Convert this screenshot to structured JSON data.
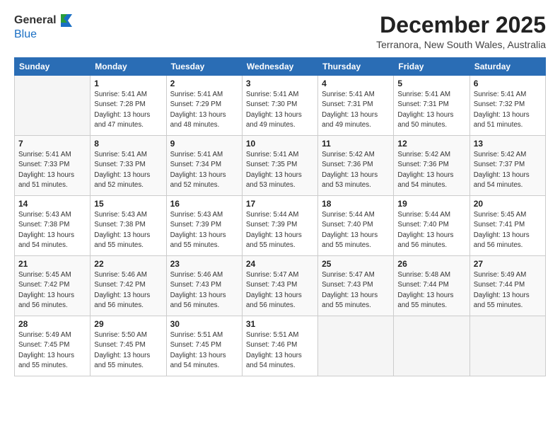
{
  "header": {
    "logo_general": "General",
    "logo_blue": "Blue",
    "month_title": "December 2025",
    "location": "Terranora, New South Wales, Australia"
  },
  "days_of_week": [
    "Sunday",
    "Monday",
    "Tuesday",
    "Wednesday",
    "Thursday",
    "Friday",
    "Saturday"
  ],
  "weeks": [
    [
      {
        "day": "",
        "sunrise": "",
        "sunset": "",
        "daylight": ""
      },
      {
        "day": "1",
        "sunrise": "Sunrise: 5:41 AM",
        "sunset": "Sunset: 7:28 PM",
        "daylight": "Daylight: 13 hours and 47 minutes."
      },
      {
        "day": "2",
        "sunrise": "Sunrise: 5:41 AM",
        "sunset": "Sunset: 7:29 PM",
        "daylight": "Daylight: 13 hours and 48 minutes."
      },
      {
        "day": "3",
        "sunrise": "Sunrise: 5:41 AM",
        "sunset": "Sunset: 7:30 PM",
        "daylight": "Daylight: 13 hours and 49 minutes."
      },
      {
        "day": "4",
        "sunrise": "Sunrise: 5:41 AM",
        "sunset": "Sunset: 7:31 PM",
        "daylight": "Daylight: 13 hours and 49 minutes."
      },
      {
        "day": "5",
        "sunrise": "Sunrise: 5:41 AM",
        "sunset": "Sunset: 7:31 PM",
        "daylight": "Daylight: 13 hours and 50 minutes."
      },
      {
        "day": "6",
        "sunrise": "Sunrise: 5:41 AM",
        "sunset": "Sunset: 7:32 PM",
        "daylight": "Daylight: 13 hours and 51 minutes."
      }
    ],
    [
      {
        "day": "7",
        "sunrise": "Sunrise: 5:41 AM",
        "sunset": "Sunset: 7:33 PM",
        "daylight": "Daylight: 13 hours and 51 minutes."
      },
      {
        "day": "8",
        "sunrise": "Sunrise: 5:41 AM",
        "sunset": "Sunset: 7:33 PM",
        "daylight": "Daylight: 13 hours and 52 minutes."
      },
      {
        "day": "9",
        "sunrise": "Sunrise: 5:41 AM",
        "sunset": "Sunset: 7:34 PM",
        "daylight": "Daylight: 13 hours and 52 minutes."
      },
      {
        "day": "10",
        "sunrise": "Sunrise: 5:41 AM",
        "sunset": "Sunset: 7:35 PM",
        "daylight": "Daylight: 13 hours and 53 minutes."
      },
      {
        "day": "11",
        "sunrise": "Sunrise: 5:42 AM",
        "sunset": "Sunset: 7:36 PM",
        "daylight": "Daylight: 13 hours and 53 minutes."
      },
      {
        "day": "12",
        "sunrise": "Sunrise: 5:42 AM",
        "sunset": "Sunset: 7:36 PM",
        "daylight": "Daylight: 13 hours and 54 minutes."
      },
      {
        "day": "13",
        "sunrise": "Sunrise: 5:42 AM",
        "sunset": "Sunset: 7:37 PM",
        "daylight": "Daylight: 13 hours and 54 minutes."
      }
    ],
    [
      {
        "day": "14",
        "sunrise": "Sunrise: 5:43 AM",
        "sunset": "Sunset: 7:38 PM",
        "daylight": "Daylight: 13 hours and 54 minutes."
      },
      {
        "day": "15",
        "sunrise": "Sunrise: 5:43 AM",
        "sunset": "Sunset: 7:38 PM",
        "daylight": "Daylight: 13 hours and 55 minutes."
      },
      {
        "day": "16",
        "sunrise": "Sunrise: 5:43 AM",
        "sunset": "Sunset: 7:39 PM",
        "daylight": "Daylight: 13 hours and 55 minutes."
      },
      {
        "day": "17",
        "sunrise": "Sunrise: 5:44 AM",
        "sunset": "Sunset: 7:39 PM",
        "daylight": "Daylight: 13 hours and 55 minutes."
      },
      {
        "day": "18",
        "sunrise": "Sunrise: 5:44 AM",
        "sunset": "Sunset: 7:40 PM",
        "daylight": "Daylight: 13 hours and 55 minutes."
      },
      {
        "day": "19",
        "sunrise": "Sunrise: 5:44 AM",
        "sunset": "Sunset: 7:40 PM",
        "daylight": "Daylight: 13 hours and 56 minutes."
      },
      {
        "day": "20",
        "sunrise": "Sunrise: 5:45 AM",
        "sunset": "Sunset: 7:41 PM",
        "daylight": "Daylight: 13 hours and 56 minutes."
      }
    ],
    [
      {
        "day": "21",
        "sunrise": "Sunrise: 5:45 AM",
        "sunset": "Sunset: 7:42 PM",
        "daylight": "Daylight: 13 hours and 56 minutes."
      },
      {
        "day": "22",
        "sunrise": "Sunrise: 5:46 AM",
        "sunset": "Sunset: 7:42 PM",
        "daylight": "Daylight: 13 hours and 56 minutes."
      },
      {
        "day": "23",
        "sunrise": "Sunrise: 5:46 AM",
        "sunset": "Sunset: 7:43 PM",
        "daylight": "Daylight: 13 hours and 56 minutes."
      },
      {
        "day": "24",
        "sunrise": "Sunrise: 5:47 AM",
        "sunset": "Sunset: 7:43 PM",
        "daylight": "Daylight: 13 hours and 56 minutes."
      },
      {
        "day": "25",
        "sunrise": "Sunrise: 5:47 AM",
        "sunset": "Sunset: 7:43 PM",
        "daylight": "Daylight: 13 hours and 55 minutes."
      },
      {
        "day": "26",
        "sunrise": "Sunrise: 5:48 AM",
        "sunset": "Sunset: 7:44 PM",
        "daylight": "Daylight: 13 hours and 55 minutes."
      },
      {
        "day": "27",
        "sunrise": "Sunrise: 5:49 AM",
        "sunset": "Sunset: 7:44 PM",
        "daylight": "Daylight: 13 hours and 55 minutes."
      }
    ],
    [
      {
        "day": "28",
        "sunrise": "Sunrise: 5:49 AM",
        "sunset": "Sunset: 7:45 PM",
        "daylight": "Daylight: 13 hours and 55 minutes."
      },
      {
        "day": "29",
        "sunrise": "Sunrise: 5:50 AM",
        "sunset": "Sunset: 7:45 PM",
        "daylight": "Daylight: 13 hours and 55 minutes."
      },
      {
        "day": "30",
        "sunrise": "Sunrise: 5:51 AM",
        "sunset": "Sunset: 7:45 PM",
        "daylight": "Daylight: 13 hours and 54 minutes."
      },
      {
        "day": "31",
        "sunrise": "Sunrise: 5:51 AM",
        "sunset": "Sunset: 7:46 PM",
        "daylight": "Daylight: 13 hours and 54 minutes."
      },
      {
        "day": "",
        "sunrise": "",
        "sunset": "",
        "daylight": ""
      },
      {
        "day": "",
        "sunrise": "",
        "sunset": "",
        "daylight": ""
      },
      {
        "day": "",
        "sunrise": "",
        "sunset": "",
        "daylight": ""
      }
    ]
  ]
}
